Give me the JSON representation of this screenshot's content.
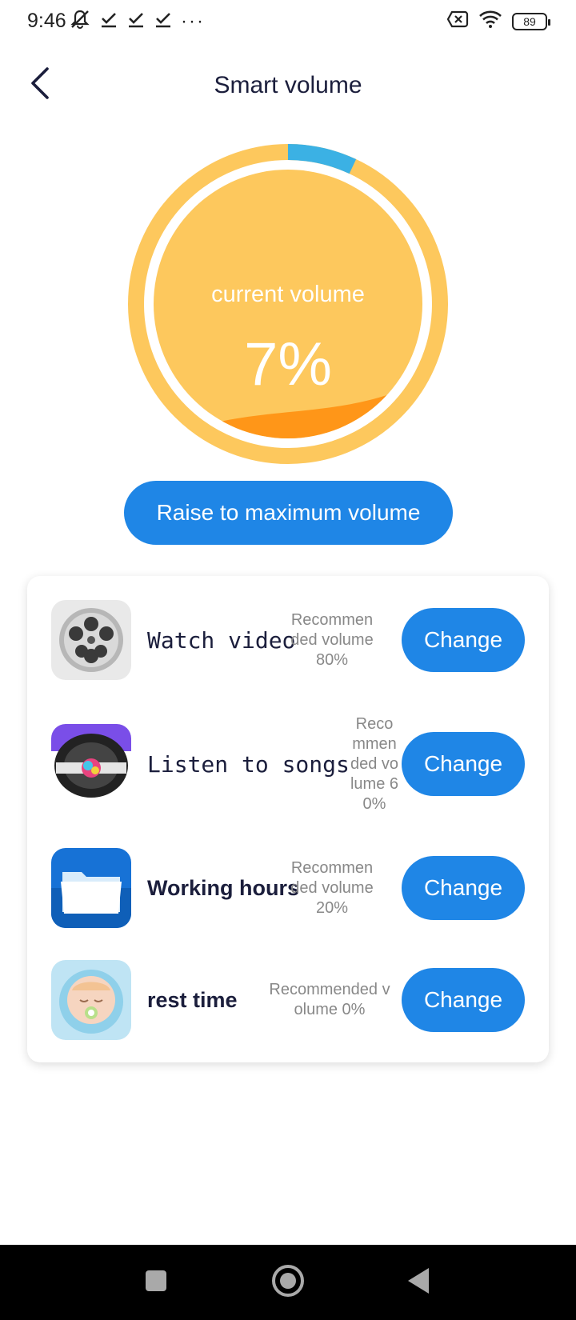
{
  "status_bar": {
    "time": "9:46",
    "battery": "89",
    "more": "···",
    "icons_left": [
      "mute-icon",
      "check-icon",
      "check-icon",
      "check-icon"
    ],
    "icons_right": [
      "sim-off-icon",
      "wifi-icon",
      "battery-icon"
    ]
  },
  "header": {
    "title": "Smart volume",
    "back_icon": "chevron-left-icon"
  },
  "gauge": {
    "label": "current volume",
    "value_text": "7%",
    "value_fraction": 0.07,
    "colors": {
      "ring": "#fdc85d",
      "progress": "#3bb1e4",
      "fill": "#fdc85d",
      "wave": "#ff9414"
    }
  },
  "raise_button": {
    "label": "Raise to maximum volume"
  },
  "scenes": [
    {
      "label": "Watch video",
      "recommendation": "Recommended volume 80%",
      "button": "Change",
      "icon": "film-reel-icon"
    },
    {
      "label": "Listen to songs",
      "recommendation": "Recommended volume 60%",
      "button": "Change",
      "icon": "vinyl-player-icon"
    },
    {
      "label": "Working hours",
      "recommendation": "Recommended volume 20%",
      "button": "Change",
      "icon": "folder-icon"
    },
    {
      "label": "rest time",
      "recommendation": "Recommended volume 0%",
      "button": "Change",
      "icon": "sleeping-baby-icon"
    }
  ],
  "nav": {
    "icons": [
      "recent-apps-icon",
      "home-icon",
      "back-icon"
    ]
  },
  "colors": {
    "accent": "#1f86e6",
    "title": "#1b1e3c"
  }
}
